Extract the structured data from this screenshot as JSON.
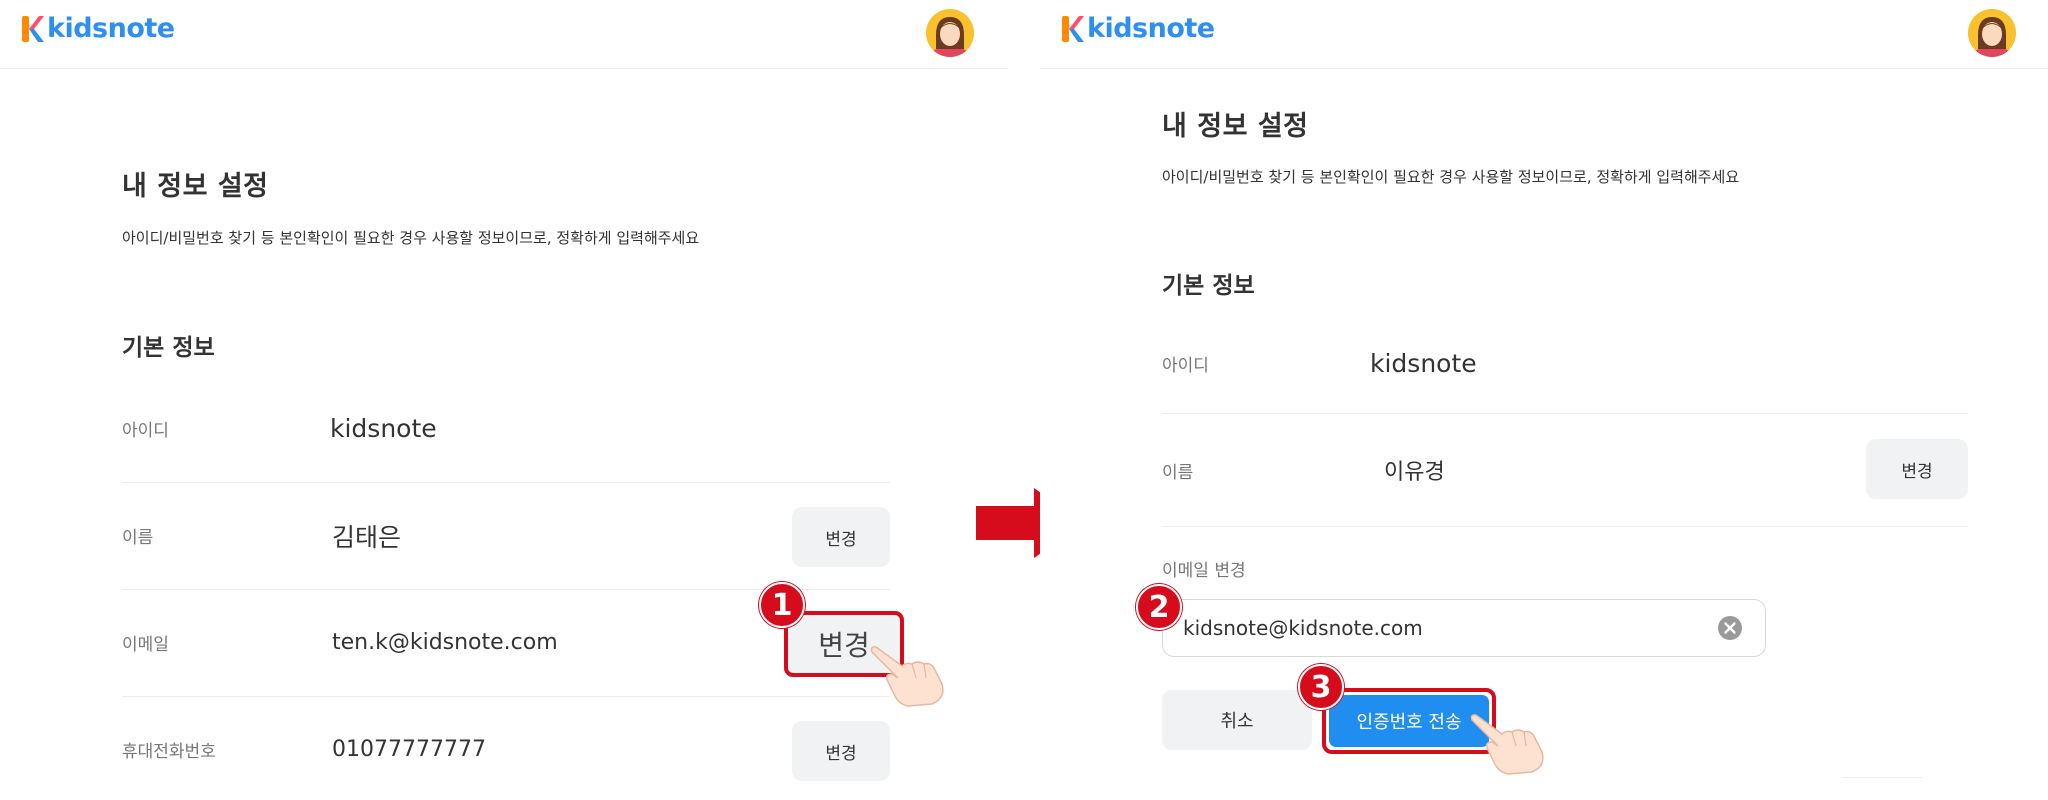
{
  "brand": {
    "name": "kidsnote",
    "logo_color": "#2e8ff0",
    "accent_red": "#d60c1d",
    "accent_blue": "#1f8ef0"
  },
  "left": {
    "title": "내 정보 설정",
    "description": "아이디/비밀번호 찾기 등 본인확인이 필요한 경우 사용할 정보이므로, 정확하게 입력해주세요",
    "section": "기본 정보",
    "rows": [
      {
        "label": "아이디",
        "value": "kidsnote"
      },
      {
        "label": "이름",
        "value": "김태은",
        "button": "변경"
      },
      {
        "label": "이메일",
        "value": "ten.k@kidsnote.com",
        "button": "변경"
      },
      {
        "label": "휴대전화번호",
        "value": "01077777777",
        "button": "변경"
      }
    ],
    "step_badge": "1"
  },
  "right": {
    "title": "내 정보 설정",
    "description": "아이디/비밀번호 찾기 등 본인확인이 필요한 경우 사용할 정보이므로, 정확하게 입력해주세요",
    "section": "기본 정보",
    "rows": [
      {
        "label": "아이디",
        "value": "kidsnote"
      },
      {
        "label": "이름",
        "value": "이유경",
        "button": "변경"
      }
    ],
    "email_change": {
      "label": "이메일 변경",
      "value": "kidsnote@kidsnote.com",
      "cancel": "취소",
      "send": "인증번호 전송"
    },
    "step_badges": [
      "2",
      "3"
    ]
  },
  "icons": [
    "kidsnote-logo-icon",
    "avatar-icon",
    "clear-icon",
    "pointing-hand-icon",
    "right-arrow-icon"
  ]
}
